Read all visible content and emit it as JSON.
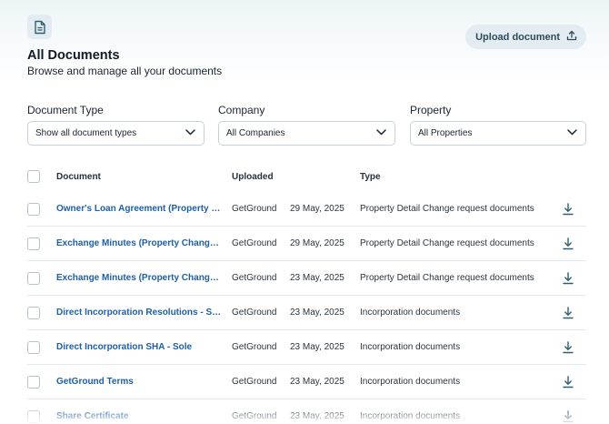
{
  "header": {
    "doc_icon": "document-icon",
    "title": "All Documents",
    "subtitle": "Browse and manage all your documents",
    "upload_label": "Upload document",
    "upload_icon": "upload-icon"
  },
  "filters": [
    {
      "label": "Document Type",
      "value": "Show all document types"
    },
    {
      "label": "Company",
      "value": "All Companies"
    },
    {
      "label": "Property",
      "value": "All Properties"
    }
  ],
  "table": {
    "headers": {
      "document": "Document",
      "uploaded": "Uploaded",
      "type": "Type"
    },
    "rows": [
      {
        "document": "Owner's Loan Agreement (Property C...",
        "uploaded_by": "GetGround",
        "date": "29 May, 2025",
        "type": "Property Detail Change request documents"
      },
      {
        "document": "Exchange Minutes (Property Change ...",
        "uploaded_by": "GetGround",
        "date": "29 May, 2025",
        "type": "Property Detail Change request documents"
      },
      {
        "document": "Exchange Minutes (Property Change ...",
        "uploaded_by": "GetGround",
        "date": "23 May, 2025",
        "type": "Property Detail Change request documents"
      },
      {
        "document": "Direct Incorporation Resolutions - Sole",
        "uploaded_by": "GetGround",
        "date": "23 May, 2025",
        "type": "Incorporation documents"
      },
      {
        "document": "Direct Incorporation SHA - Sole",
        "uploaded_by": "GetGround",
        "date": "23 May, 2025",
        "type": "Incorporation documents"
      },
      {
        "document": "GetGround Terms",
        "uploaded_by": "GetGround",
        "date": "23 May, 2025",
        "type": "Incorporation documents"
      },
      {
        "document": "Share Certificate",
        "uploaded_by": "GetGround",
        "date": "23 May, 2025",
        "type": "Incorporation documents"
      }
    ]
  },
  "colors": {
    "accent_link": "#1f5fa6",
    "badge_bg": "#e3edf1",
    "icon_teal": "#2f5f6e"
  }
}
